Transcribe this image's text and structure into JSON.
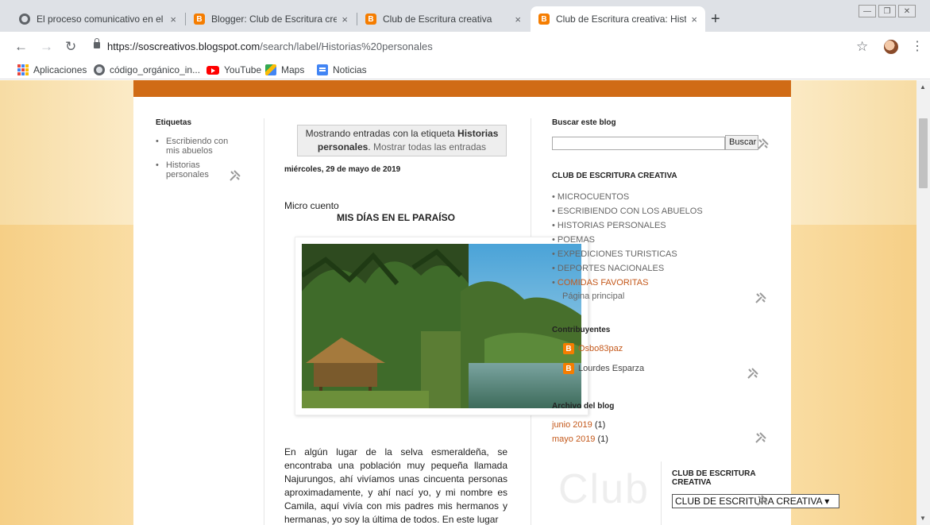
{
  "browser": {
    "tabs": [
      {
        "title": "El proceso comunicativo en el de",
        "icon": "globe-icon",
        "active": false
      },
      {
        "title": "Blogger: Club de Escritura creativ",
        "icon": "blogger-icon",
        "active": false
      },
      {
        "title": "Club de Escritura creativa",
        "icon": "blogger-icon",
        "active": false
      },
      {
        "title": "Club de Escritura creativa: Histori",
        "icon": "blogger-icon",
        "active": true
      }
    ],
    "tab_close": "×",
    "new_tab": "+",
    "url_host": "https://soscreativos.blogspot.com",
    "url_path": "/search/label/Historias%20personales",
    "bookmarks": [
      {
        "label": "Aplicaciones",
        "icon": "apps-icon"
      },
      {
        "label": "código_orgánico_in...",
        "icon": "globe-icon"
      },
      {
        "label": "YouTube",
        "icon": "youtube-icon"
      },
      {
        "label": "Maps",
        "icon": "maps-icon"
      },
      {
        "label": "Noticias",
        "icon": "news-icon"
      }
    ]
  },
  "sidebar": {
    "title": "Etiquetas",
    "items": [
      "Escribiendo con mis abuelos",
      "Historias personales"
    ]
  },
  "main": {
    "label_box": {
      "prefix": "Mostrando entradas con la etiqueta",
      "label": "Historias personales",
      "suffix": ".",
      "show_all": "Mostrar todas las entradas"
    },
    "post": {
      "date": "miércoles, 29 de mayo de 2019",
      "label": "Micro cuento",
      "title": "MIS DÍAS EN EL PARAÍSO",
      "body": "En algún lugar de la selva esmeraldeña, se encontraba una población muy pequeña llamada Najurungos, ahí vivíamos unas cincuenta personas aproximadamente, y ahí nací yo, y mi nombre es Camila, aquí vivía con mis padres mis hermanos y hermanas, yo soy la última de todos. En este lugar"
    }
  },
  "right": {
    "search_title": "Buscar este blog",
    "search_button": "Buscar",
    "club_title": "CLUB DE ESCRITURA CREATIVA",
    "club_items": [
      "MICROCUENTOS",
      "ESCRIBIENDO CON LOS ABUELOS",
      "HISTORIAS PERSONALES",
      "POEMAS",
      "EXPEDICIONES TURISTICAS",
      "DEPORTES NACIONALES",
      "COMIDAS FAVORITAS"
    ],
    "home_link": "Página principal",
    "contributors_title": "Contribuyentes",
    "contributors": [
      "Osbo83paz",
      "Lourdes Esparza"
    ],
    "archive_title": "Archivo del blog",
    "archive": [
      {
        "month": "junio 2019",
        "count": "(1)"
      },
      {
        "month": "mayo 2019",
        "count": "(1)"
      }
    ],
    "watermark": "Club",
    "club2_title": "CLUB DE ESCRITURA CREATIVA",
    "club_select": "CLUB DE ESCRITURA CREATIVA"
  },
  "colors": {
    "accent_orange": "#d06b16",
    "link_orange": "#c4581a",
    "page_bg": "#fbe2ae"
  }
}
